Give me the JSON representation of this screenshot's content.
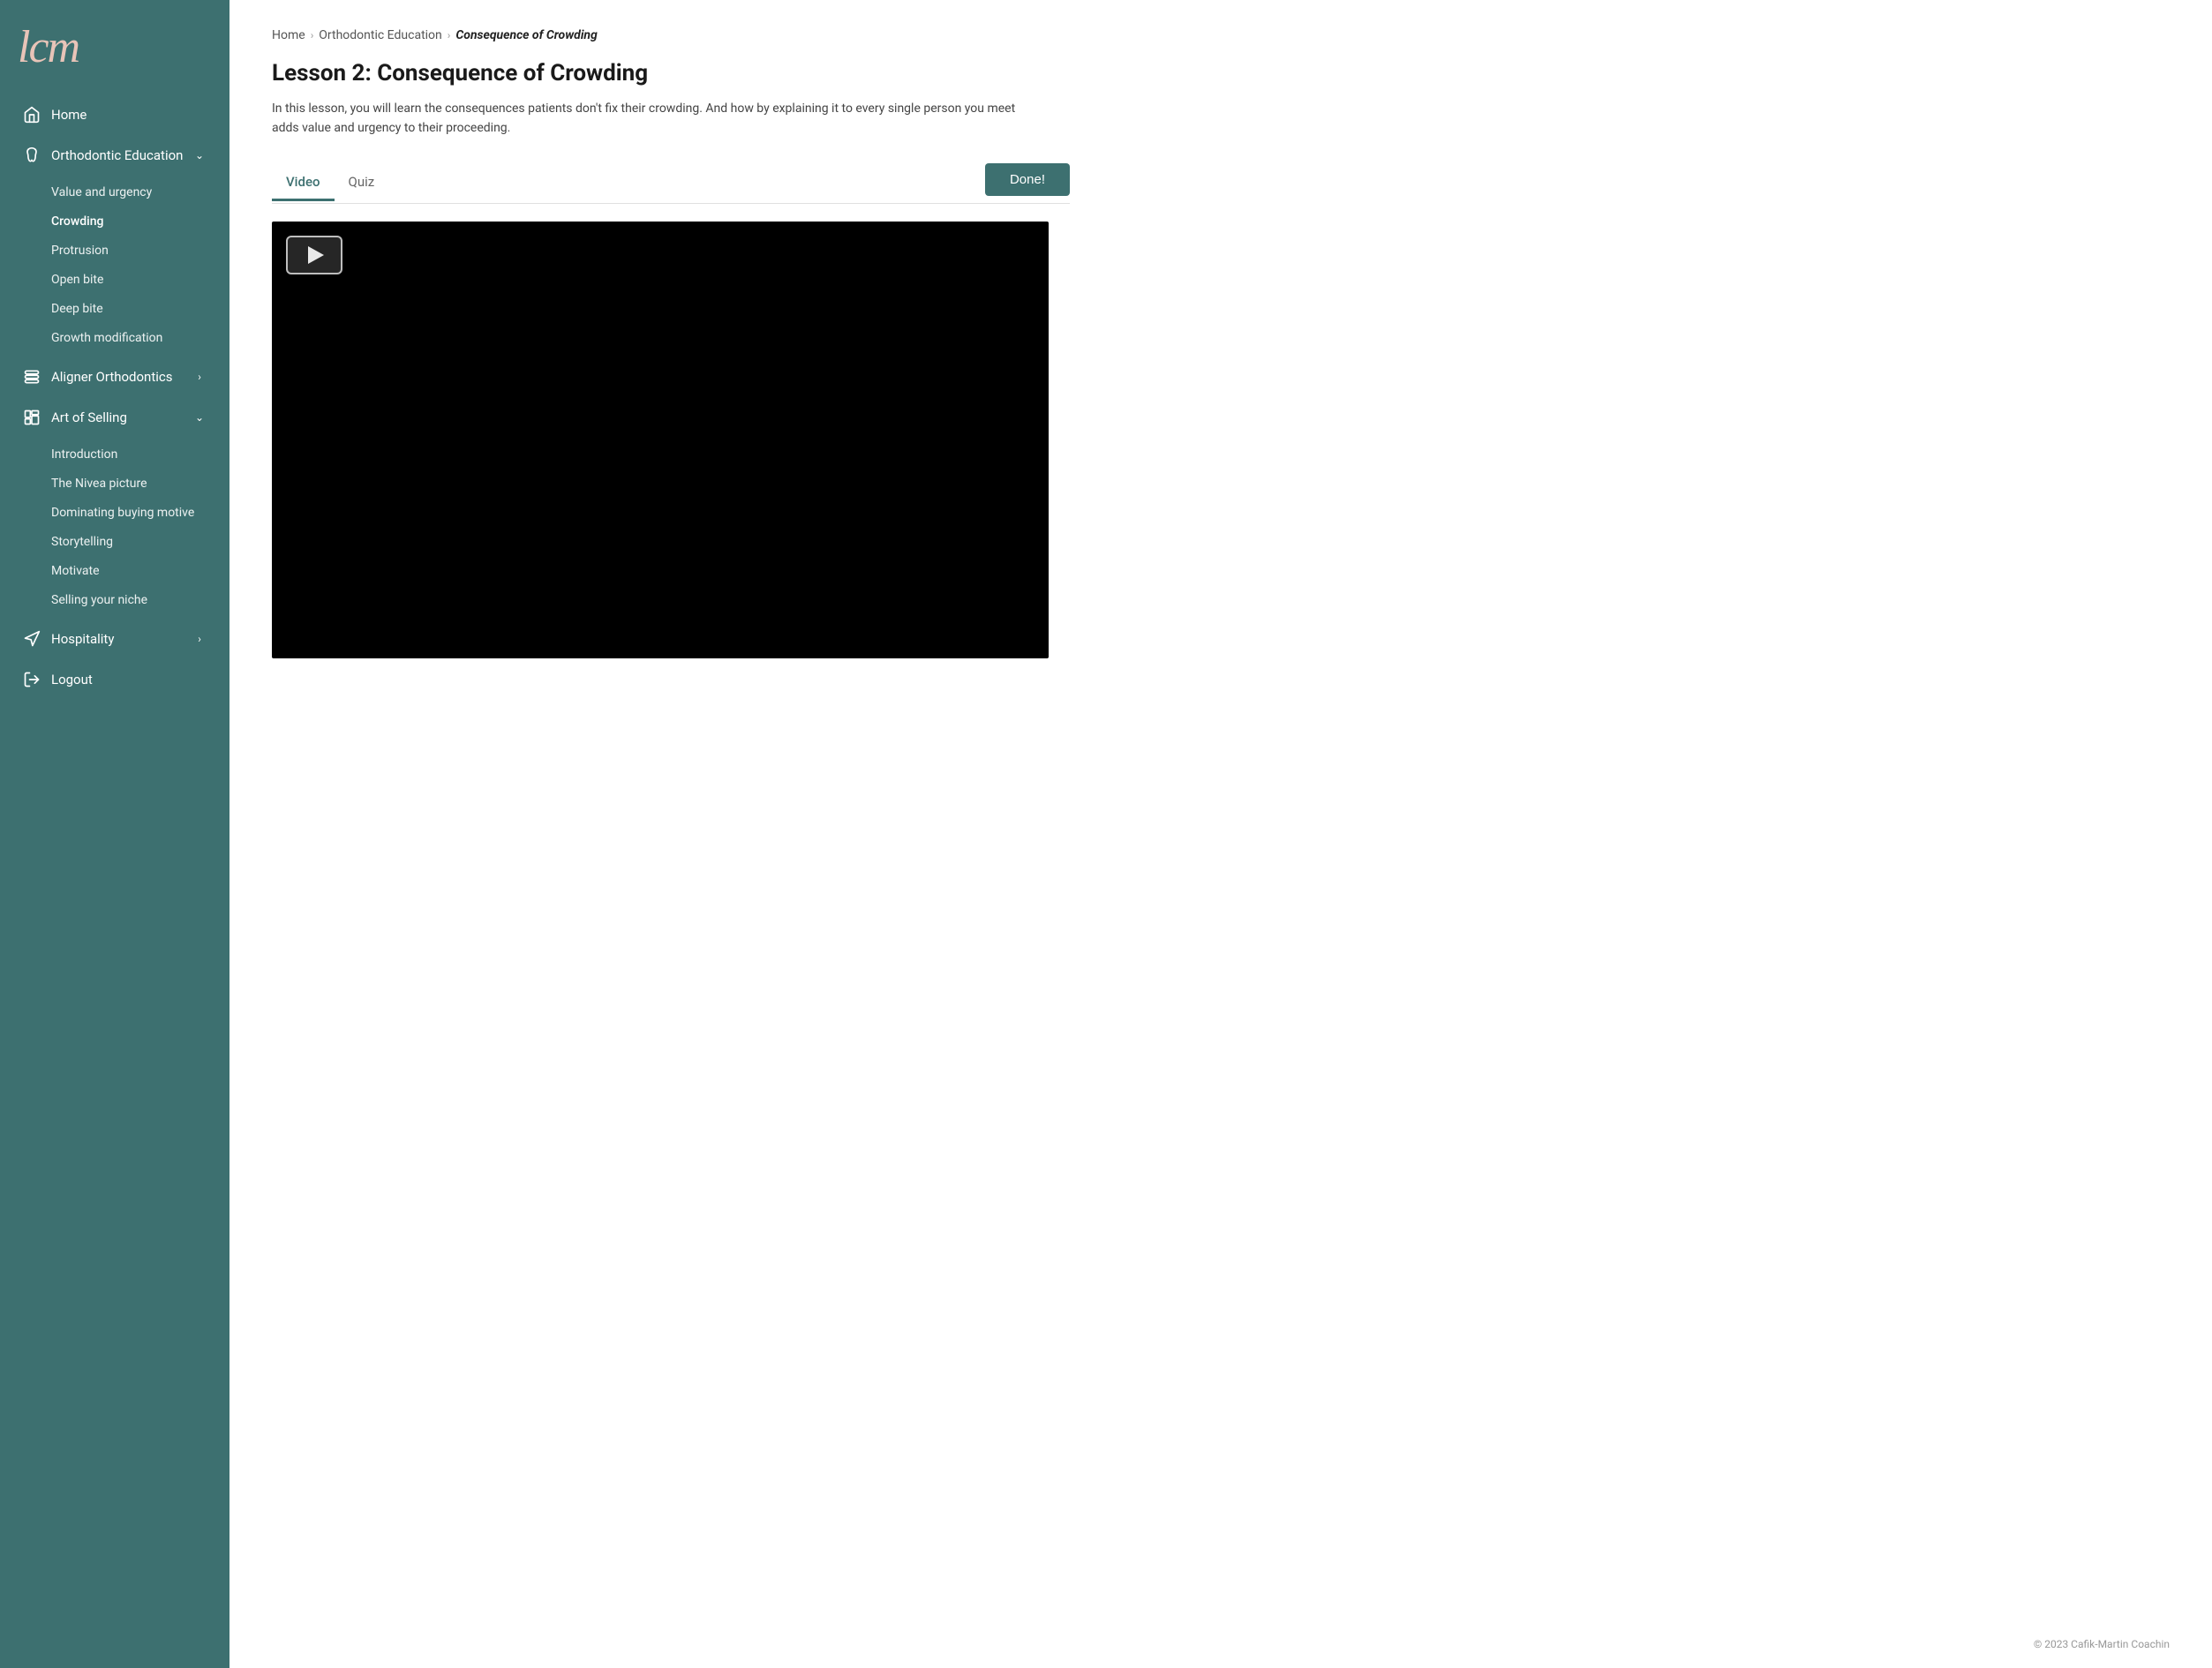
{
  "sidebar": {
    "logo": "lcm",
    "nav": [
      {
        "id": "home",
        "label": "Home",
        "icon": "home-icon",
        "hasChevron": false,
        "expanded": false
      },
      {
        "id": "orthodontic-education",
        "label": "Orthodontic Education",
        "icon": "tooth-icon",
        "hasChevron": true,
        "expanded": true,
        "children": [
          {
            "id": "value-urgency",
            "label": "Value and urgency"
          },
          {
            "id": "crowding",
            "label": "Crowding",
            "active": true
          },
          {
            "id": "protrusion",
            "label": "Protrusion"
          },
          {
            "id": "open-bite",
            "label": "Open bite"
          },
          {
            "id": "deep-bite",
            "label": "Deep bite"
          },
          {
            "id": "growth-modification",
            "label": "Growth modification"
          }
        ]
      },
      {
        "id": "aligner-orthodontics",
        "label": "Aligner Orthodontics",
        "icon": "aligner-icon",
        "hasChevron": true,
        "expanded": false,
        "chevronDir": "right"
      },
      {
        "id": "art-of-selling",
        "label": "Art of Selling",
        "icon": "selling-icon",
        "hasChevron": true,
        "expanded": true,
        "children": [
          {
            "id": "introduction",
            "label": "Introduction"
          },
          {
            "id": "nivea-picture",
            "label": "The Nivea picture"
          },
          {
            "id": "dominating-buying",
            "label": "Dominating buying motive"
          },
          {
            "id": "storytelling",
            "label": "Storytelling"
          },
          {
            "id": "motivate",
            "label": "Motivate"
          },
          {
            "id": "selling-niche",
            "label": "Selling your niche"
          }
        ]
      },
      {
        "id": "hospitality",
        "label": "Hospitality",
        "icon": "hospitality-icon",
        "hasChevron": true,
        "expanded": false,
        "chevronDir": "right"
      },
      {
        "id": "logout",
        "label": "Logout",
        "icon": "logout-icon",
        "hasChevron": false,
        "expanded": false
      }
    ]
  },
  "breadcrumb": {
    "home": "Home",
    "section": "Orthodontic Education",
    "current": "Consequence of Crowding"
  },
  "lesson": {
    "title": "Lesson 2: Consequence of Crowding",
    "description": "In this lesson, you will learn the consequences patients don't fix their crowding. And how by explaining it to every single person you meet adds value and urgency to their proceeding."
  },
  "tabs": [
    {
      "id": "video",
      "label": "Video",
      "active": true
    },
    {
      "id": "quiz",
      "label": "Quiz",
      "active": false
    }
  ],
  "buttons": {
    "done": "Done!"
  },
  "footer": {
    "copyright": "© 2023 Cafik-Martin Coachin"
  }
}
